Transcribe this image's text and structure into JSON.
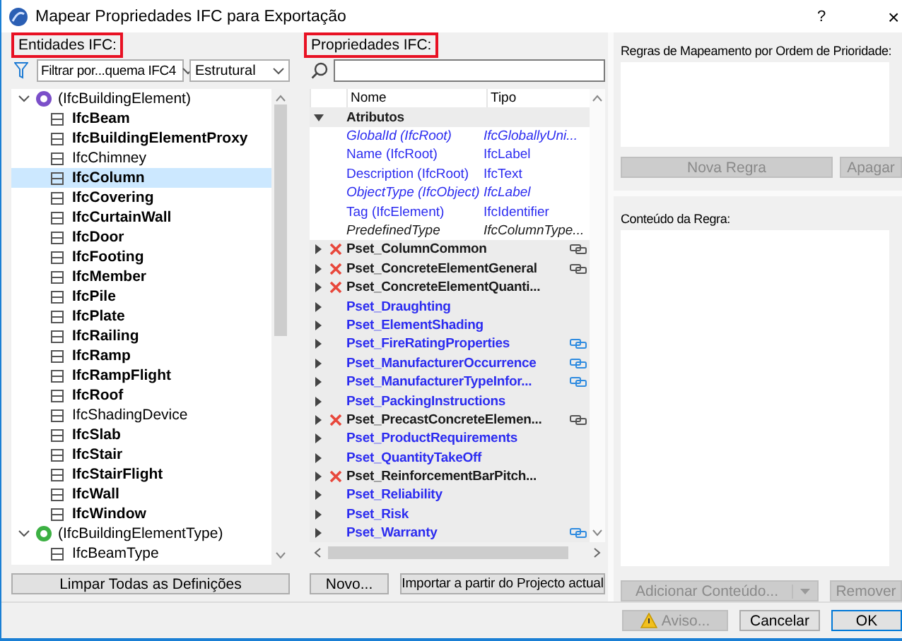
{
  "window": {
    "title": "Mapear Propriedades IFC para Exportação",
    "help_button": "?",
    "close_button": "×"
  },
  "entities": {
    "label": "Entidades IFC:",
    "highlighted": true,
    "filter": "Filtrar por...quema IFC4",
    "domain": "Estrutural",
    "tree": [
      {
        "label": "(IfcBuildingElement)",
        "expanded": true,
        "selected": false,
        "color": "#7b4fc9",
        "children": [
          {
            "label": "IfcBeam",
            "defined": true,
            "selected": false
          },
          {
            "label": "IfcBuildingElementProxy",
            "defined": true,
            "selected": false
          },
          {
            "label": "IfcChimney",
            "defined": false,
            "selected": false
          },
          {
            "label": "IfcColumn",
            "defined": true,
            "selected": true
          },
          {
            "label": "IfcCovering",
            "defined": true,
            "selected": false
          },
          {
            "label": "IfcCurtainWall",
            "defined": true,
            "selected": false
          },
          {
            "label": "IfcDoor",
            "defined": true,
            "selected": false
          },
          {
            "label": "IfcFooting",
            "defined": true,
            "selected": false
          },
          {
            "label": "IfcMember",
            "defined": true,
            "selected": false
          },
          {
            "label": "IfcPile",
            "defined": true,
            "selected": false
          },
          {
            "label": "IfcPlate",
            "defined": true,
            "selected": false
          },
          {
            "label": "IfcRailing",
            "defined": true,
            "selected": false
          },
          {
            "label": "IfcRamp",
            "defined": true,
            "selected": false
          },
          {
            "label": "IfcRampFlight",
            "defined": true,
            "selected": false
          },
          {
            "label": "IfcRoof",
            "defined": true,
            "selected": false
          },
          {
            "label": "IfcShadingDevice",
            "defined": false,
            "selected": false
          },
          {
            "label": "IfcSlab",
            "defined": true,
            "selected": false
          },
          {
            "label": "IfcStair",
            "defined": true,
            "selected": false
          },
          {
            "label": "IfcStairFlight",
            "defined": true,
            "selected": false
          },
          {
            "label": "IfcWall",
            "defined": true,
            "selected": false
          },
          {
            "label": "IfcWindow",
            "defined": true,
            "selected": false
          }
        ]
      },
      {
        "label": "(IfcBuildingElementType)",
        "expanded": true,
        "selected": false,
        "color": "#3cb043",
        "children": [
          {
            "label": "IfcBeamType",
            "defined": false,
            "selected": false
          }
        ]
      }
    ],
    "clear_button": "Limpar Todas as Definições"
  },
  "properties": {
    "label": "Propriedades IFC:",
    "highlighted": true,
    "columns": [
      "Nome",
      "Tipo"
    ],
    "attributes": {
      "name": "Atributos",
      "expanded": true,
      "items": [
        {
          "name": "GlobalId (IfcRoot)",
          "type": "IfcGloballyUni...",
          "mapped": true,
          "optional": true
        },
        {
          "name": "Name (IfcRoot)",
          "type": "IfcLabel",
          "mapped": true,
          "optional": false
        },
        {
          "name": "Description (IfcRoot)",
          "type": "IfcText",
          "mapped": true,
          "optional": false
        },
        {
          "name": "ObjectType (IfcObject)",
          "type": "IfcLabel",
          "mapped": true,
          "optional": true
        },
        {
          "name": "Tag (IfcElement)",
          "type": "IfcIdentifier",
          "mapped": true,
          "optional": false
        },
        {
          "name": "PredefinedType",
          "type": "IfcColumnType...",
          "mapped": false,
          "optional": true
        }
      ]
    },
    "psets": [
      {
        "name": "Pset_ColumnCommon",
        "excluded": true,
        "linked": true,
        "link_active": false,
        "expanded": false
      },
      {
        "name": "Pset_ConcreteElementGeneral",
        "excluded": true,
        "linked": true,
        "link_active": false,
        "expanded": false
      },
      {
        "name": "Pset_ConcreteElementQuanti...",
        "excluded": true,
        "linked": false,
        "expanded": false
      },
      {
        "name": "Pset_Draughting",
        "excluded": false,
        "linked": false,
        "expanded": false
      },
      {
        "name": "Pset_ElementShading",
        "excluded": false,
        "linked": false,
        "expanded": false
      },
      {
        "name": "Pset_FireRatingProperties",
        "excluded": false,
        "linked": true,
        "link_active": true,
        "expanded": false
      },
      {
        "name": "Pset_ManufacturerOccurrence",
        "excluded": false,
        "linked": true,
        "link_active": true,
        "expanded": false
      },
      {
        "name": "Pset_ManufacturerTypeInfor...",
        "excluded": false,
        "linked": true,
        "link_active": true,
        "expanded": false
      },
      {
        "name": "Pset_PackingInstructions",
        "excluded": false,
        "linked": false,
        "expanded": false
      },
      {
        "name": "Pset_PrecastConcreteElemen...",
        "excluded": true,
        "linked": true,
        "link_active": false,
        "expanded": false
      },
      {
        "name": "Pset_ProductRequirements",
        "excluded": false,
        "linked": false,
        "expanded": false
      },
      {
        "name": "Pset_QuantityTakeOff",
        "excluded": false,
        "linked": false,
        "expanded": false
      },
      {
        "name": "Pset_ReinforcementBarPitch...",
        "excluded": true,
        "linked": false,
        "expanded": false
      },
      {
        "name": "Pset_Reliability",
        "excluded": false,
        "linked": false,
        "expanded": false
      },
      {
        "name": "Pset_Risk",
        "excluded": false,
        "linked": false,
        "expanded": false
      },
      {
        "name": "Pset_Warranty",
        "excluded": false,
        "linked": true,
        "link_active": true,
        "expanded": false
      }
    ],
    "new_button": {
      "label": "Novo...",
      "disabled": false
    },
    "import_button": {
      "label": "Importar a partir do Projecto actual",
      "disabled": false
    }
  },
  "rules": {
    "label": "Regras de Mapeamento por Ordem de Prioridade:",
    "new_button": {
      "label": "Nova Regra",
      "disabled": true
    },
    "delete_button": {
      "label": "Apagar",
      "disabled": true
    },
    "content_label": "Conteúdo da Regra:",
    "add_button": {
      "label": "Adicionar Conteúdo...",
      "disabled": true
    },
    "remove_button": {
      "label": "Remover",
      "disabled": true
    }
  },
  "footer": [
    {
      "kind": "warning",
      "label": "Aviso...",
      "disabled": true,
      "default": false
    },
    {
      "kind": "plain",
      "label": "Cancelar",
      "disabled": false,
      "default": false
    },
    {
      "kind": "plain",
      "label": "OK",
      "disabled": false,
      "default": true
    }
  ]
}
